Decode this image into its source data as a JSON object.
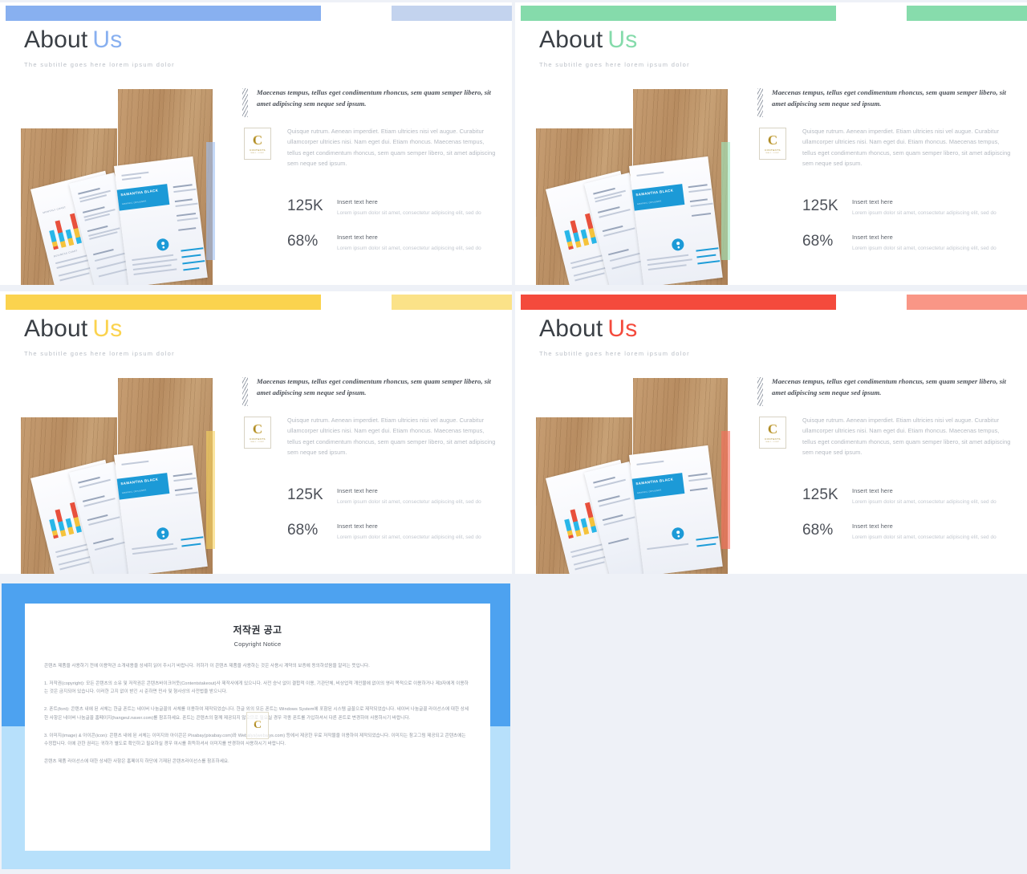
{
  "deck": {
    "slides": [
      {
        "id": "slide-blue",
        "accent": "#88b0f0",
        "accent_soft": "#c3d3ee",
        "accent_strip": "#9fc0f2",
        "title_main": "About",
        "title_accent": "Us",
        "subtitle": "The subtitle goes here lorem ipsum dolor",
        "quote": "Maecenas tempus, tellus eget condimentum rhoncus, sem quam semper libero, sit amet adipiscing sem neque sed ipsum.",
        "body": "Quisque rutrum. Aenean imperdiet. Etiam ultricies nisi vel augue. Curabitur ullamcorper ultricies nisi. Nam eget dui. Etiam rhoncus. Maecenas tempus, tellus eget condimentum rhoncus, sem quam semper libero, sit amet adipiscing sem neque sed ipsum.",
        "stats": [
          {
            "value": "125K",
            "heading": "Insert  text here",
            "desc": "Lorem ipsum dolor sit amet, consectetur adipiscing elit, sed do"
          },
          {
            "value": "68%",
            "heading": "Insert  text here",
            "desc": "Lorem ipsum dolor sit amet, consectetur adipiscing elit, sed do"
          }
        ]
      },
      {
        "id": "slide-green",
        "accent": "#85dbab",
        "accent_soft": "#87dcac",
        "accent_strip": "#9fe8bf",
        "title_main": "About",
        "title_accent": "Us",
        "subtitle": "The subtitle goes here lorem ipsum dolor",
        "quote": "Maecenas tempus, tellus eget condimentum rhoncus, sem quam semper libero, sit amet adipiscing sem neque sed ipsum.",
        "body": "Quisque rutrum. Aenean imperdiet. Etiam ultricies nisi vel augue. Curabitur ullamcorper ultricies nisi. Nam eget dui. Etiam rhoncus. Maecenas tempus, tellus eget condimentum rhoncus, sem quam semper libero, sit amet adipiscing sem neque sed ipsum.",
        "stats": [
          {
            "value": "125K",
            "heading": "Insert  text here",
            "desc": "Lorem ipsum dolor sit amet, consectetur adipiscing elit, sed do"
          },
          {
            "value": "68%",
            "heading": "Insert  text here",
            "desc": "Lorem ipsum dolor sit amet, consectetur adipiscing elit, sed do"
          }
        ]
      },
      {
        "id": "slide-yellow",
        "accent": "#fbd34e",
        "accent_soft": "#fbe288",
        "accent_strip": "#f7d461",
        "title_main": "About",
        "title_accent": "Us",
        "subtitle": "The subtitle goes here lorem ipsum dolor",
        "quote": "Maecenas tempus, tellus eget condimentum rhoncus, sem quam semper libero, sit amet adipiscing sem neque sed ipsum.",
        "body": "Quisque rutrum. Aenean imperdiet. Etiam ultricies nisi vel augue. Curabitur ullamcorper ultricies nisi. Nam eget dui. Etiam rhoncus. Maecenas tempus, tellus eget condimentum rhoncus, sem quam semper libero, sit amet adipiscing sem neque sed ipsum.",
        "stats": [
          {
            "value": "125K",
            "heading": "Insert  text here",
            "desc": "Lorem ipsum dolor sit amet, consectetur adipiscing elit, sed do"
          },
          {
            "value": "68%",
            "heading": "Insert  text here",
            "desc": "Lorem ipsum dolor sit amet, consectetur adipiscing elit, sed do"
          }
        ]
      },
      {
        "id": "slide-red",
        "accent": "#f44a3c",
        "accent_soft": "#f99686",
        "accent_strip": "#f9705c",
        "title_main": "About",
        "title_accent": "Us",
        "subtitle": "The subtitle goes here lorem ipsum dolor",
        "quote": "Maecenas tempus, tellus eget condimentum rhoncus, sem quam semper libero, sit amet adipiscing sem neque sed ipsum.",
        "body": "Quisque rutrum. Aenean imperdiet. Etiam ultricies nisi vel augue. Curabitur ullamcorper ultricies nisi. Nam eget dui. Etiam rhoncus. Maecenas tempus, tellus eget condimentum rhoncus, sem quam semper libero, sit amet adipiscing sem neque sed ipsum.",
        "stats": [
          {
            "value": "125K",
            "heading": "Insert  text here",
            "desc": "Lorem ipsum dolor sit amet, consectetur adipiscing elit, sed do"
          },
          {
            "value": "68%",
            "heading": "Insert  text here",
            "desc": "Lorem ipsum dolor sit amet, consectetur adipiscing elit, sed do"
          }
        ]
      }
    ],
    "photo": {
      "resume_name": "SAMANTHA BLACK",
      "resume_role": "GRAPHIC DESIGNER",
      "chart_caption_top": "MONTHLY CHART",
      "chart_caption_bottom": "BUSINESS CHART"
    },
    "logo": {
      "letter": "C",
      "name": "CONTENTS",
      "tagline": "MALL  CORP"
    }
  },
  "copyright_slide": {
    "frame_top_color": "#4da2f0",
    "frame_bottom_color": "#b7e0fb",
    "heading_ko": "저작권 공고",
    "heading_en": "Copyright Notice",
    "paragraphs": [
      "콘텐츠 제품을 사용하기 전에 이용약관 소개내용을 상세히 읽어 주시기 바랍니다. 귀하가 이 콘텐츠 제품을 사용하는 것은 사용시 계약의 보증에 동의하셨음을 알리는 뜻입니다.",
      "1. 저작권(copyright): 모든 콘텐츠의 소유 및 저작권은 콘텐츠바이크어웃(Contentstakeout)사 제작사에게 있으니다. 사전 승낙 없이 결합적 이용, 기관단체, 비상업적 개인물에 없이의 영리 목적으로 이용하거나 제3자에게 이용하는 것은 금지되어 있습니다. 이러한 고지 없이 받긴 시 준하면 민사 및 형사상의 사전법을 받으니다.",
      "2. 폰트(font): 콘텐츠 내에 된 서체는 한글 폰트는 네이버 나눔글꼴의 서체를 이용하여 제작되었습니다. 한글 외의 모든 폰트는 Windows System에 포함된 시스템 글꼴으로 제작되었습니다. 네이버 나눔글꼴 라이선스에 대한 상세한 사항은 네이버 나눔글꼴 홈페이지(hangeul.naver.com)를 참조하세요. 폰트는 콘텐츠의 함께 제공되지 않으므로 필요실 경우 각종 폰트를 가입하셔서 다른 폰트로 변경하여 사용하시기 바랍니다.",
      "3. 이미지(image) & 아이콘(icon): 콘텐츠 내에 된 서체는 이미지와 아이콘은 Pixabay(pixabay.com)와 Webalys(webalys.com) 등에서 제공한 무료 저작물을 이용하여 제작되었습니다. 이미지는 참고그림 제공되고 콘텐츠에는 수정합니다. 이에 관한 권리는 귀하가 별도로 확인하고 필요하실 경우 여시를 취득하셔서 이미지를 반경하여 사용하시기 바랍니다.",
      "콘텐츠 제품 라이선스에 대한 상세한 사항은 홈페이지 하단에 기재된 콘텐츠라이선스를 참조하세요."
    ],
    "watermark_letter": "C"
  }
}
